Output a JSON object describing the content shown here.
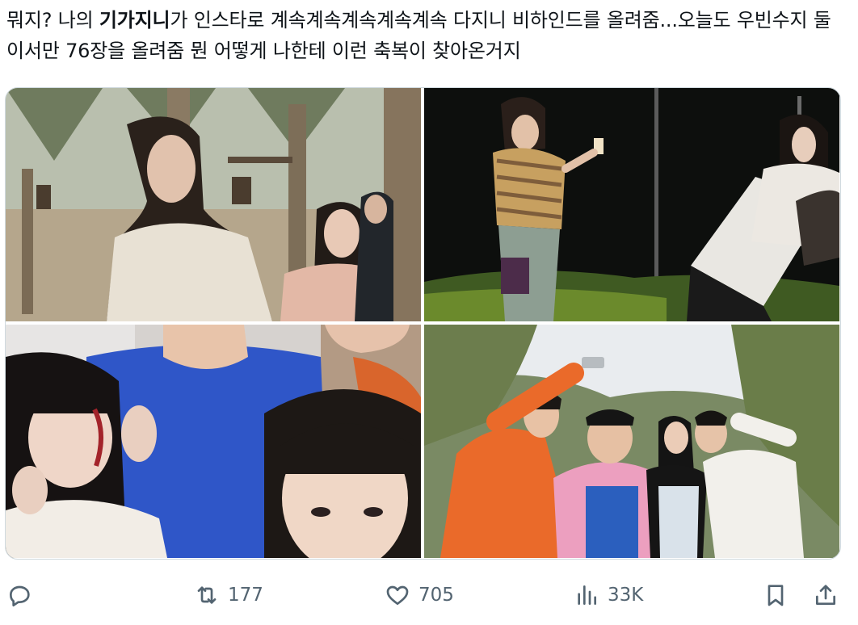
{
  "tweet": {
    "text_part1": "뭐지? 나의 ",
    "text_bold": "기가지니",
    "text_part2": "가 인스타로 계속계속계속계속계속 다지니 비하인드를 올려줌...오늘도 우빈수지 둘이서만 76장을 올려줌 뭔 어떻게 나한테 이런 축복이 찾아온거지"
  },
  "media": {
    "images": [
      {
        "scene": "palm-grove-costume"
      },
      {
        "scene": "night-set-selfie"
      },
      {
        "scene": "group-closeup-makeup"
      },
      {
        "scene": "group-selfie-outdoor"
      }
    ]
  },
  "actions": {
    "reply": {
      "icon": "reply-icon",
      "count": ""
    },
    "retweet": {
      "icon": "retweet-icon",
      "count": "177"
    },
    "like": {
      "icon": "heart-icon",
      "count": "705"
    },
    "views": {
      "icon": "views-icon",
      "count": "33K"
    },
    "bookmark": {
      "icon": "bookmark-icon"
    },
    "share": {
      "icon": "share-icon"
    }
  },
  "colors": {
    "text": "#0f1419",
    "secondary": "#536471",
    "border": "#cfd9de"
  }
}
